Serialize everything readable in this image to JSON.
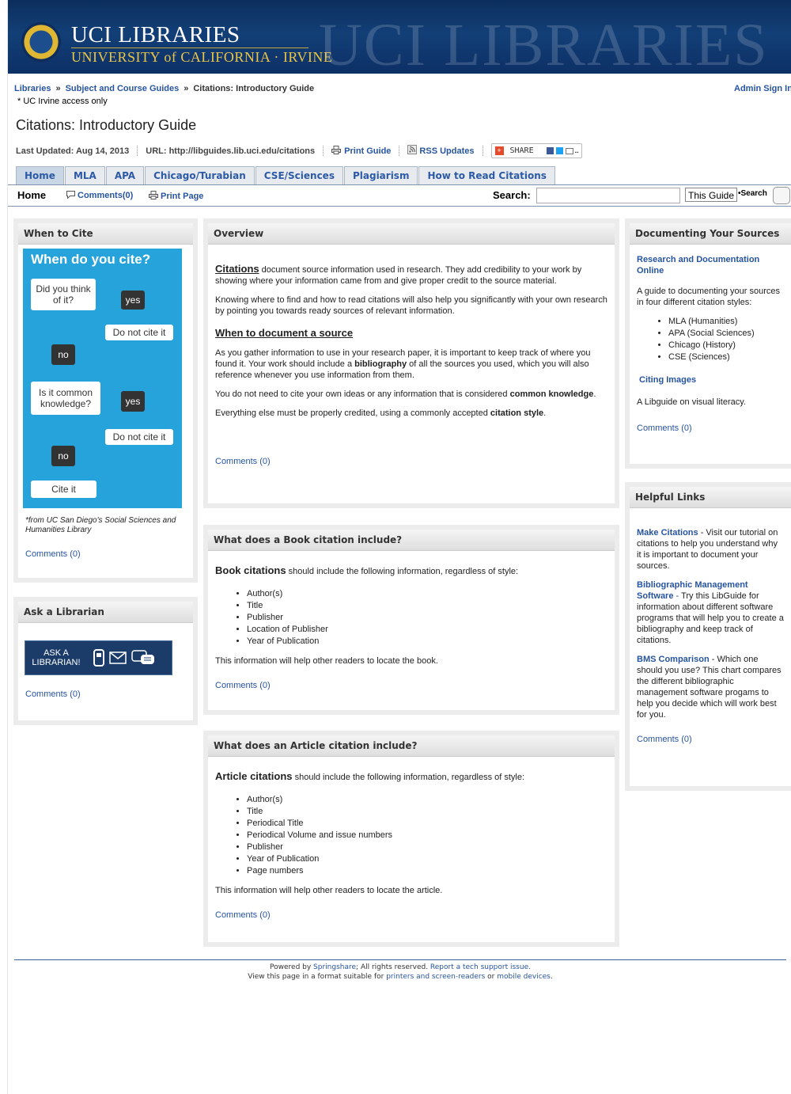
{
  "header": {
    "logo_title": "UCI LIBRARIES",
    "logo_subtitle": "UNIVERSITY of CALIFORNIA · IRVINE",
    "watermark": "UCI LIBRARIES"
  },
  "breadcrumb": {
    "items": [
      "Libraries",
      "Subject and Course Guides"
    ],
    "separator": "»",
    "current": "Citations: Introductory Guide"
  },
  "admin_link": "Admin Sign In",
  "access_note": "* UC Irvine access only",
  "page_title": "Citations: Introductory Guide",
  "meta": {
    "last_updated": "Last Updated: Aug 14, 2013",
    "url": "URL: http://libguides.lib.uci.edu/citations",
    "print_guide": "Print Guide",
    "rss": "RSS Updates",
    "share": "SHARE"
  },
  "tabs": [
    "Home",
    "MLA",
    "APA",
    "Chicago/Turabian",
    "CSE/Sciences",
    "Plagiarism",
    "How to Read Citations"
  ],
  "subnav": {
    "home": "Home",
    "comments": "Comments(0)",
    "print_page": "Print Page",
    "search_label": "Search:",
    "search_value": "",
    "scope": "This Guide",
    "search_button": "•Search"
  },
  "when_to_cite": {
    "title": "When to Cite",
    "graphic": {
      "heading": "When do you cite?",
      "q1": "Did you think of it?",
      "yes1": "yes",
      "a1": "Do not cite it",
      "no1": "no",
      "q2": "Is it common knowledge?",
      "yes2": "yes",
      "a2": "Do not cite it",
      "no2": "no",
      "end": "Cite it"
    },
    "caption": "*from UC San Diego's Social Sciences and Humanities Library",
    "comments": "Comments (0)"
  },
  "ask_librarian": {
    "title": "Ask a Librarian",
    "button_line1": "ASK A",
    "button_line2": "LIBRARIAN!",
    "comments": "Comments (0)"
  },
  "overview": {
    "title": "Overview",
    "citations_word": "Citations",
    "p1_rest": " document source information used in research. They add credibility to your work by showing where your information came from and give proper credit to the source material.",
    "p2": "Knowing where to find and how to read citations will also help you significantly with your own research by pointing you towards ready sources of relevant information.",
    "subheading": "When to document a source",
    "p3_a": "As you gather information to use in your research paper, it is important to keep track of where you found it. Your work should include a ",
    "p3_b": "bibliography",
    "p3_c": " of all the sources you used, which you will also reference whenever you use information from them.",
    "p4_a": "You do not need to cite your own ideas or any information that is considered ",
    "p4_b": "common knowledge",
    "p4_c": ".",
    "p5_a": "Everything else must be properly credited, using a commonly accepted ",
    "p5_b": "citation style",
    "p5_c": ".",
    "comments": "Comments (0)"
  },
  "book": {
    "title": "What does a Book citation include?",
    "lead_bold": "Book citations",
    "lead_rest": " should include the following information, regardless of style:",
    "items": [
      "Author(s)",
      "Title",
      "Publisher",
      "Location of Publisher",
      "Year of Publication"
    ],
    "closing": "This information will help other readers to locate the book.",
    "comments": "Comments (0)"
  },
  "article": {
    "title": "What does an Article citation include?",
    "lead_bold": "Article citations",
    "lead_rest": " should include the following information, regardless of style:",
    "items": [
      "Author(s)",
      "Title",
      "Periodical Title",
      "Periodical Volume and issue numbers",
      "Publisher",
      "Year of Publication",
      "Page numbers"
    ],
    "closing": "This information will help other readers to locate the article.",
    "comments": "Comments (0)"
  },
  "documenting": {
    "title": "Documenting Your Sources",
    "link": "Research and Documentation Online",
    "desc": "A guide to documenting your sources in four different citation styles:",
    "items": [
      "MLA (Humanities)",
      "APA (Social Sciences)",
      "Chicago (History)",
      "CSE (Sciences)"
    ],
    "citing_images": "Citing Images",
    "citing_desc": "A Libguide on visual literacy.",
    "comments": "Comments (0)"
  },
  "helpful": {
    "title": "Helpful Links",
    "l1": "Make Citations",
    "l1_desc": "Visit our tutorial on citations to help you understand why it is important to document your sources.",
    "l2": "Bibliographic Management Software",
    "l2_desc": "Try this LibGuide for information about different software programs that will help you to create a bibliography and keep track of citations.",
    "l3": "BMS Comparison",
    "l3_desc": "Which one should you use? This chart compares the different bibliographic management software progams to help you decide which will work best for you.",
    "comments": "Comments (0)"
  },
  "footer": {
    "powered_by": "Powered by ",
    "springshare": "Springshare",
    "rights": "; All rights reserved. ",
    "report": "Report a tech support issue.",
    "view_text": "View this page in a format suitable for ",
    "printers": "printers and screen-readers",
    "or": " or ",
    "mobile": "mobile devices",
    "period": "."
  },
  "colors": {
    "link": "#2754a0",
    "banner": "#123f77",
    "chart_blue": "#27a3db"
  }
}
